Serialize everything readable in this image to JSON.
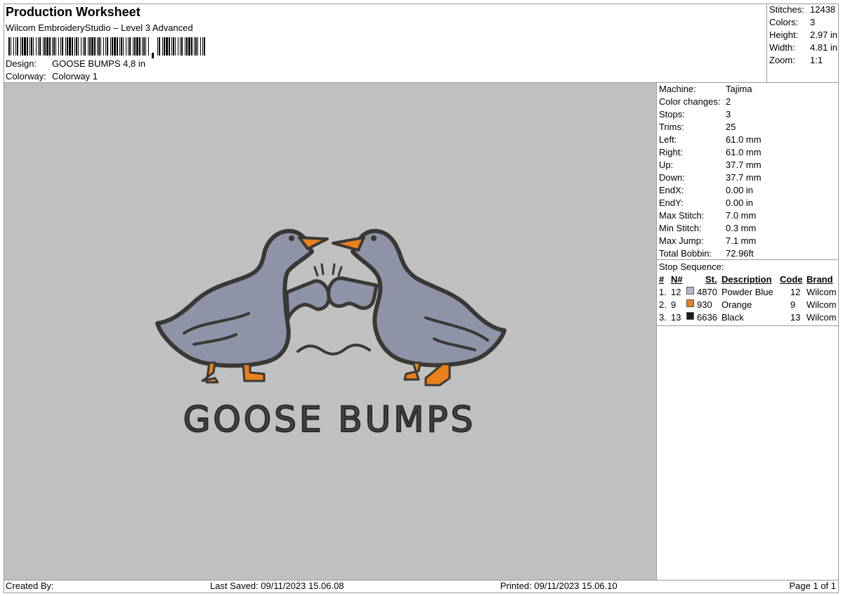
{
  "header": {
    "title": "Production Worksheet",
    "software": "Wilcom EmbroideryStudio – Level 3 Advanced",
    "design_label": "Design:",
    "design_value": "GOOSE BUMPS 4,8 in",
    "colorway_label": "Colorway:",
    "colorway_value": "Colorway 1"
  },
  "summary": {
    "stitches_label": "Stitches:",
    "stitches_value": "12438",
    "colors_label": "Colors:",
    "colors_value": "3",
    "height_label": "Height:",
    "height_value": "2.97 in",
    "width_label": "Width:",
    "width_value": "4.81 in",
    "zoom_label": "Zoom:",
    "zoom_value": "1:1"
  },
  "machine": {
    "rows": [
      {
        "label": "Machine:",
        "value": "Tajima"
      },
      {
        "label": "Color changes:",
        "value": "2"
      },
      {
        "label": "Stops:",
        "value": "3"
      },
      {
        "label": "Trims:",
        "value": "25"
      },
      {
        "label": "Left:",
        "value": "61.0 mm"
      },
      {
        "label": "Right:",
        "value": "61.0 mm"
      },
      {
        "label": "Up:",
        "value": "37.7 mm"
      },
      {
        "label": "Down:",
        "value": "37.7 mm"
      },
      {
        "label": "EndX:",
        "value": "0.00 in"
      },
      {
        "label": "EndY:",
        "value": "0.00 in"
      },
      {
        "label": "Max Stitch:",
        "value": "7.0 mm"
      },
      {
        "label": "Min Stitch:",
        "value": "0.3 mm"
      },
      {
        "label": "Max Jump:",
        "value": "7.1 mm"
      },
      {
        "label": "Total Bobbin:",
        "value": "72.96ft"
      }
    ]
  },
  "stop_sequence": {
    "title": "Stop Sequence:",
    "headers": {
      "num": "#",
      "needle": "N#",
      "st": "St.",
      "description": "Description",
      "code": "Code",
      "brand": "Brand"
    },
    "rows": [
      {
        "num": "1.",
        "needle": "12",
        "color": "#b9b7d8",
        "st": "4870",
        "description": "Powder Blue",
        "code": "12",
        "brand": "Wilcom"
      },
      {
        "num": "2.",
        "needle": "9",
        "color": "#e8801c",
        "st": "930",
        "description": "Orange",
        "code": "9",
        "brand": "Wilcom"
      },
      {
        "num": "3.",
        "needle": "13",
        "color": "#1c1c1a",
        "st": "6636",
        "description": "Black",
        "code": "13",
        "brand": "Wilcom"
      }
    ]
  },
  "design_preview": {
    "text": "GOOSE BUMPS",
    "colors": {
      "background": "#c0c0c0",
      "body": "#8e93a8",
      "beak": "#e8801c",
      "outline": "#3a3835"
    }
  },
  "footer": {
    "created_by": "Created By:",
    "last_saved": "Last Saved: 09/11/2023 15.06.08",
    "printed": "Printed: 09/11/2023 15.06.10",
    "page": "Page 1 of 1"
  }
}
